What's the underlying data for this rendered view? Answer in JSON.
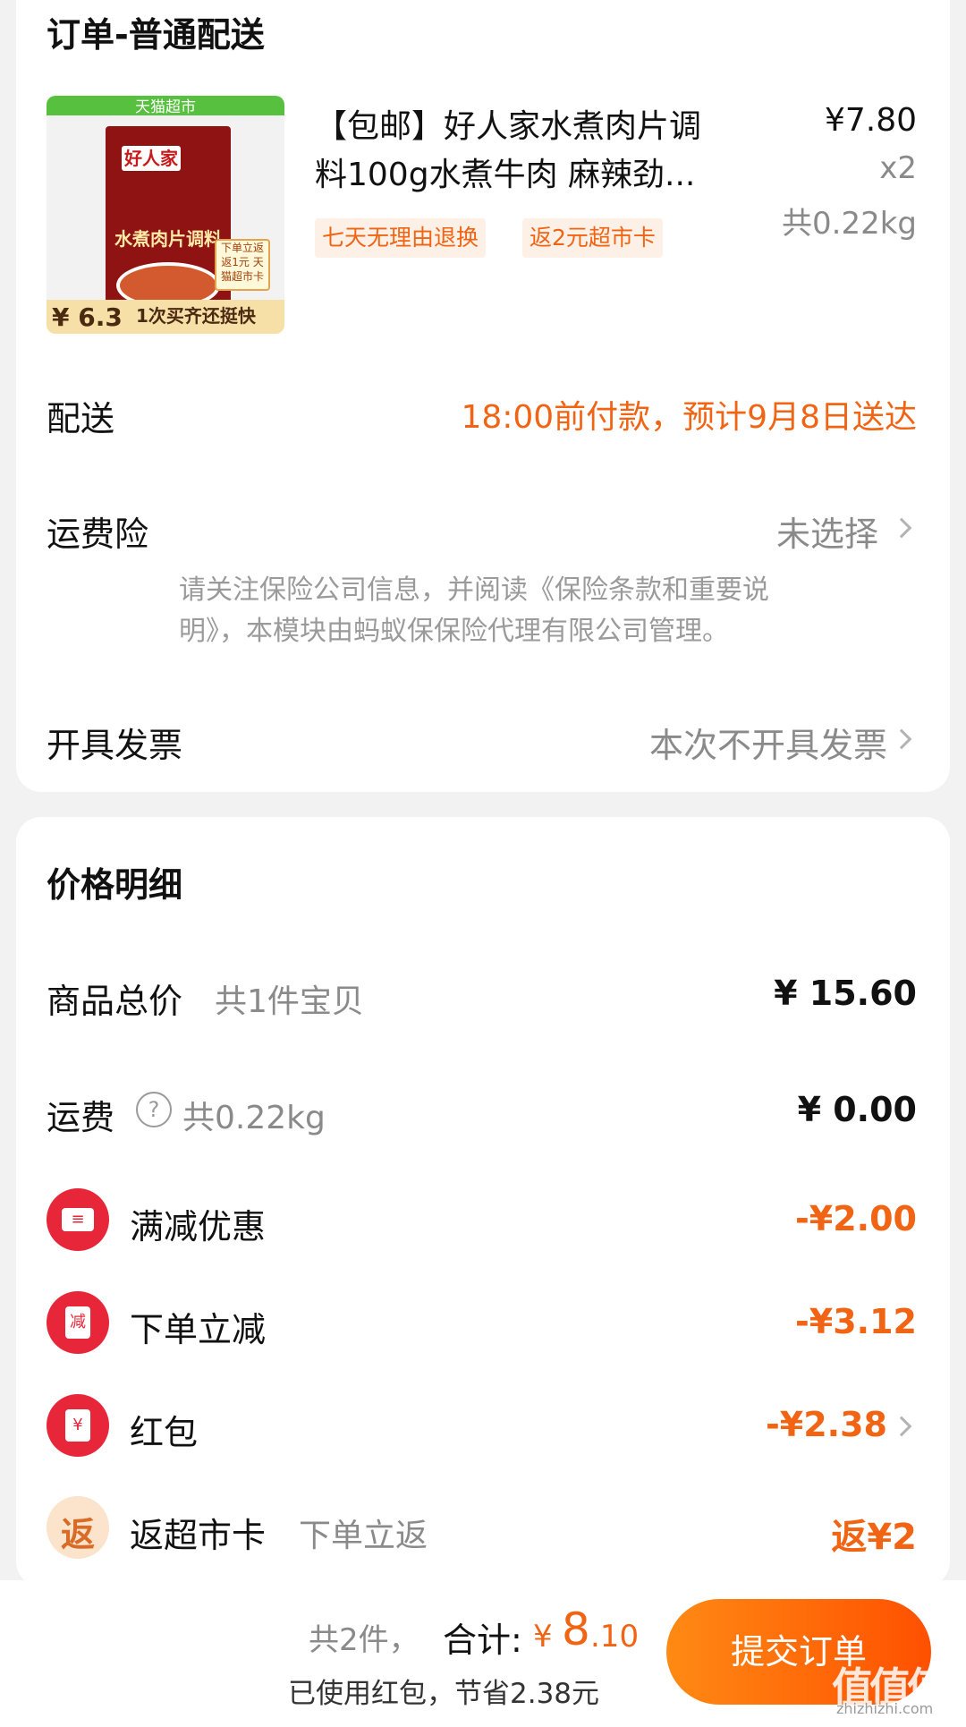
{
  "order": {
    "section_title": "订单-普通配送",
    "product": {
      "image": {
        "store_tag": "天猫超市",
        "brand": "好人家",
        "name": "水煮肉片调料",
        "badge": "下单立返 返1元 天猫超市卡",
        "price": "¥ 6.3",
        "bottom_text": "1次买齐还挺快"
      },
      "title_line1": "【包邮】好人家水煮肉片调",
      "title_line2": "料100g水煮牛肉 麻辣劲...",
      "price": "¥7.80",
      "qty": "x2",
      "weight": "共0.22kg",
      "tags": [
        "七天无理由退换",
        "返2元超市卡"
      ]
    },
    "delivery": {
      "label": "配送",
      "value": "18:00前付款，预计9月8日送达"
    },
    "insurance": {
      "label": "运费险",
      "value": "未选择",
      "note_line1": "请关注保险公司信息，并阅读《保险条款和重要说",
      "note_line2": "明》，本模块由蚂蚁保保险代理有限公司管理。"
    },
    "invoice": {
      "label": "开具发票",
      "value": "本次不开具发票"
    }
  },
  "price_detail": {
    "title": "价格明细",
    "goods_total": {
      "label": "商品总价",
      "sub": "共1件宝贝",
      "value": "¥ 15.60"
    },
    "shipping": {
      "label": "运费",
      "sub": "共0.22kg",
      "value": "¥ 0.00",
      "help_icon": "question-circle-icon"
    },
    "discounts": [
      {
        "label": "满减优惠",
        "value": "-¥2.00",
        "icon": "coupon-icon"
      },
      {
        "label": "下单立减",
        "value": "-¥3.12",
        "icon": "reduce-icon",
        "icon_text": "减"
      },
      {
        "label": "红包",
        "value": "-¥2.38",
        "icon": "red-envelope-icon",
        "icon_text": "¥"
      },
      {
        "label": "返超市卡",
        "sub": "下单立返",
        "value": "返¥2",
        "icon": "cashback-icon",
        "icon_text": "返"
      }
    ]
  },
  "footer": {
    "count": "共2件，",
    "total_label": "合计:",
    "currency": "¥",
    "total_int": "8",
    "total_dec": ".10",
    "saved": "已使用红包，节省2.38元",
    "submit": "提交订单"
  },
  "watermark": {
    "text": "值值值",
    "site": "zhizhizhi.com"
  },
  "colors": {
    "accent": "#f06414",
    "button": "#ff5000",
    "red_icon": "#e8263a"
  }
}
